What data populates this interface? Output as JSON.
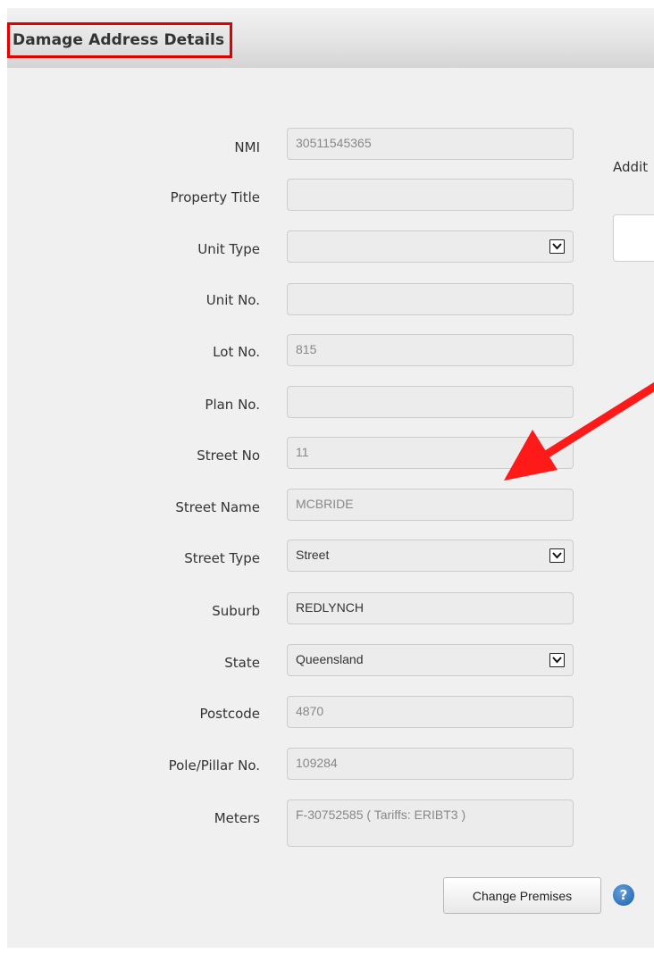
{
  "section": {
    "title": "Damage Address Details"
  },
  "fields": [
    {
      "label": "NMI",
      "value": "30511545365",
      "type": "text"
    },
    {
      "label": "Property Title",
      "value": "",
      "type": "text"
    },
    {
      "label": "Unit Type",
      "value": "",
      "type": "select"
    },
    {
      "label": "Unit No.",
      "value": "",
      "type": "text"
    },
    {
      "label": "Lot No.",
      "value": "815",
      "type": "text"
    },
    {
      "label": "Plan No.",
      "value": "",
      "type": "text"
    },
    {
      "label": "Street No",
      "value": "11",
      "type": "text"
    },
    {
      "label": "Street Name",
      "value": "MCBRIDE",
      "type": "text"
    },
    {
      "label": "Street Type",
      "value": "Street",
      "type": "select"
    },
    {
      "label": "Suburb",
      "value": "REDLYNCH",
      "type": "text"
    },
    {
      "label": "State",
      "value": "Queensland",
      "type": "select"
    },
    {
      "label": "Postcode",
      "value": "4870",
      "type": "text"
    },
    {
      "label": "Pole/Pillar No.",
      "value": "109284",
      "type": "text"
    },
    {
      "label": "Meters",
      "value": "F-30752585 ( Tariffs: ERIBT3 )",
      "type": "textarea"
    }
  ],
  "side": {
    "additional_label": "Addit"
  },
  "actions": {
    "change_premises_label": "Change Premises",
    "help_icon": "?"
  },
  "icons": {
    "select_arrow": "chevron-down-icon",
    "help": "help-icon",
    "annotation": "red-arrow-icon"
  },
  "colors": {
    "highlight_border": "#e00000",
    "annotation_arrow": "#ff1a1a",
    "help_icon": "#2a6fba"
  }
}
